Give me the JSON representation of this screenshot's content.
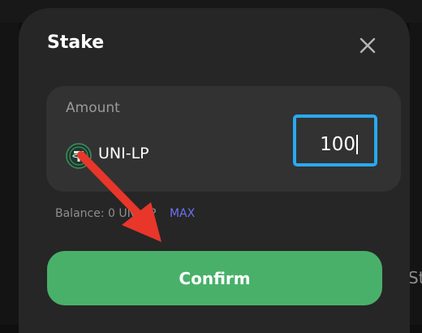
{
  "modal": {
    "title": "Stake",
    "close_icon": "close-icon"
  },
  "amount": {
    "label": "Amount",
    "token_icon": "tether-icon",
    "token_name": "UNI-LP",
    "input_value": "100"
  },
  "balance": {
    "text": "Balance: 0 UNI-LP",
    "max_label": "MAX"
  },
  "confirm": {
    "label": "Confirm"
  },
  "background": {
    "tab_label_fragment": "St"
  },
  "colors": {
    "modal_bg": "#262626",
    "amount_box_bg": "#323232",
    "input_focus_border": "#29a9f0",
    "confirm_button": "#49b06a",
    "max_link": "#6c72f3",
    "annotation_arrow": "#e8362a"
  }
}
